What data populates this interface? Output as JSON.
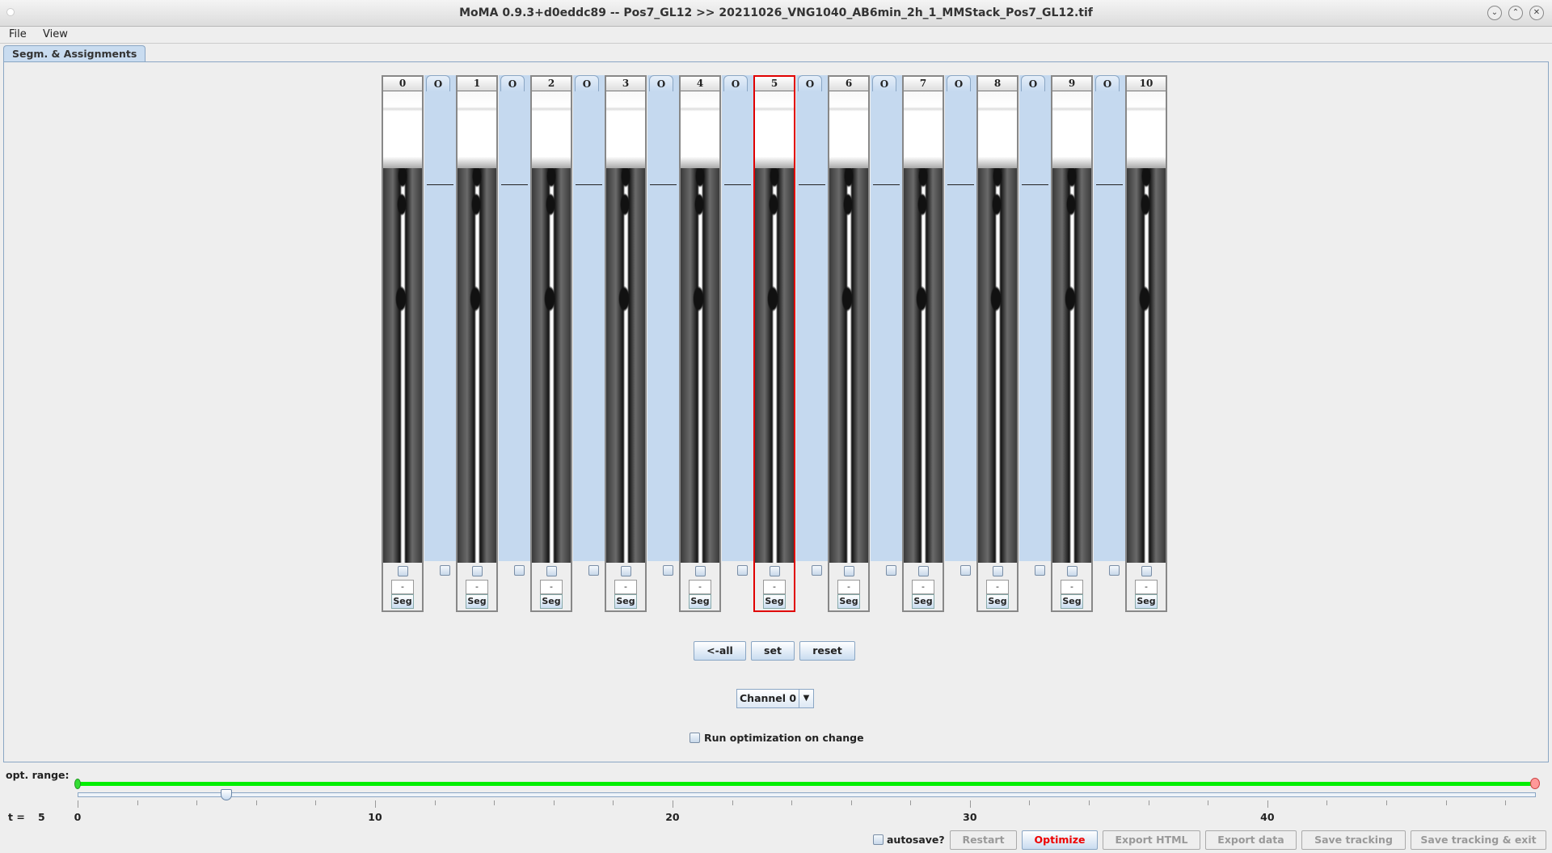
{
  "window": {
    "title": "MoMA 0.9.3+d0eddc89 -- Pos7_GL12 >> 20211026_VNG1040_AB6min_2h_1_MMStack_Pos7_GL12.tif",
    "controls": [
      "minimize-icon",
      "maximize-icon",
      "close-icon"
    ]
  },
  "menu": [
    "File",
    "View"
  ],
  "tab": "Segm. & Assignments",
  "columns": [
    {
      "label": "0"
    },
    {
      "label": "1"
    },
    {
      "label": "2"
    },
    {
      "label": "3"
    },
    {
      "label": "4"
    },
    {
      "label": "5",
      "selected": true
    },
    {
      "label": "6"
    },
    {
      "label": "7"
    },
    {
      "label": "8"
    },
    {
      "label": "9"
    },
    {
      "label": "10"
    }
  ],
  "gap_label": "O",
  "column_count_value": "-",
  "column_seg_label": "Seg",
  "buttons": {
    "all": "<-all",
    "set": "set",
    "reset": "reset"
  },
  "channel": {
    "selected": "Channel 0"
  },
  "run_opt": {
    "label": "Run optimization on change",
    "checked": false
  },
  "slider": {
    "label": "opt. range:",
    "range_min": 0,
    "range_max": 49,
    "t_label": "t =",
    "t_value": "5",
    "ticks": [
      "0",
      "10",
      "20",
      "30",
      "40"
    ],
    "accent": "#00ee00"
  },
  "footer": {
    "autosave": "autosave?",
    "restart": "Restart",
    "optimize": "Optimize",
    "export_html": "Export HTML",
    "export_data": "Export data",
    "save_tracking": "Save tracking",
    "save_exit": "Save tracking & exit",
    "optimize_color": "#ee0000"
  }
}
